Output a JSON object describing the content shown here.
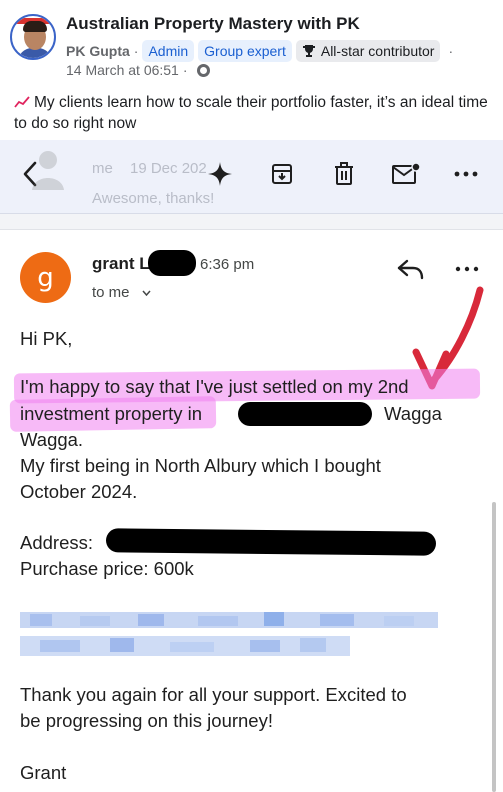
{
  "post": {
    "group_name": "Australian Property Mastery with PK",
    "author": "PK Gupta",
    "badges": [
      "Admin",
      "Group expert",
      "All-star contributor"
    ],
    "timestamp": "14 March at 06:51",
    "text": "My clients learn how to scale their portfolio faster, it’s an ideal time to do so right now"
  },
  "toolbar": {
    "ghost_sender": "me",
    "ghost_date": "19 Dec 202",
    "ghost_snippet": "Awesome, thanks!",
    "icons": [
      "back-icon",
      "sparkle-icon",
      "archive-icon",
      "trash-icon",
      "mark-unread-icon",
      "more-icon"
    ]
  },
  "email": {
    "avatar_letter": "g",
    "sender": "grant L",
    "time": "6:36 pm",
    "recipient": "to me",
    "greeting": "Hi PK,",
    "line1": "I'm happy to say that I've just settled on my 2nd",
    "line2a": "investment property",
    "line2b": " in",
    "line2c": "Wagga",
    "line3": "Wagga.",
    "line4": "My first being in North Albury which I bought",
    "line5": "October 2024.",
    "address_label": "Address:",
    "price": "Purchase price: 600k",
    "thanks1": "Thank you again for all your support. Excited to",
    "thanks2": "be progressing on this journey!",
    "signoff": "Grant"
  },
  "colors": {
    "accent_blue": "#1a5fd1",
    "avatar_orange": "#ee6b14",
    "highlight_pink": "#f082f0",
    "arrow_red": "#d8293a"
  }
}
